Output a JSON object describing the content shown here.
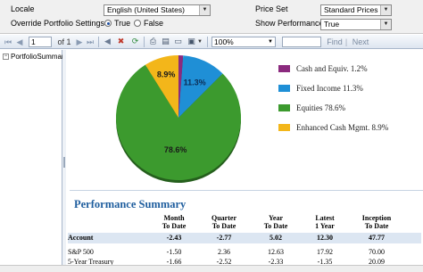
{
  "params": {
    "locale_label": "Locale",
    "locale_value": "English (United States)",
    "override_label": "Override Portfolio Settings",
    "true_label": "True",
    "false_label": "False",
    "price_set_label": "Price Set",
    "price_set_value": "Standard Prices",
    "show_perf_label": "Show Performance",
    "show_perf_value": "True"
  },
  "toolbar": {
    "page_value": "1",
    "of_label": "of 1",
    "zoom_value": "100%",
    "find_label": "Find",
    "next_label": "Next"
  },
  "docmap": {
    "node_label": "PortfolioSummary"
  },
  "chart_data": {
    "type": "pie",
    "slices": [
      {
        "label": "Cash and Equiv.",
        "value": 1.2,
        "color": "#8b2a7e"
      },
      {
        "label": "Fixed Income",
        "value": 11.3,
        "color": "#1f8fd6"
      },
      {
        "label": "Equities",
        "value": 78.6,
        "color": "#3c9a2e"
      },
      {
        "label": "Enhanced Cash Mgmt.",
        "value": 8.9,
        "color": "#f3b61a"
      }
    ],
    "data_labels": [
      "11.3%",
      "78.6%",
      "8.9%"
    ],
    "legend_position": "right"
  },
  "legend": [
    {
      "text": "Cash and Equiv. 1.2%",
      "color": "#8b2a7e"
    },
    {
      "text": "Fixed Income 11.3%",
      "color": "#1f8fd6"
    },
    {
      "text": "Equities 78.6%",
      "color": "#3c9a2e"
    },
    {
      "text": "Enhanced Cash Mgmt. 8.9%",
      "color": "#f3b61a"
    }
  ],
  "performance": {
    "title": "Performance Summary",
    "headers": [
      {
        "l1": "Month",
        "l2": "To Date"
      },
      {
        "l1": "Quarter",
        "l2": "To Date"
      },
      {
        "l1": "Year",
        "l2": "To Date"
      },
      {
        "l1": "Latest",
        "l2": "1 Year"
      },
      {
        "l1": "Inception",
        "l2": "To Date"
      }
    ],
    "rows": [
      {
        "name": "Account",
        "values": [
          "-2.43",
          "-2.77",
          "5.02",
          "12.30",
          "47.77"
        ]
      },
      {
        "name": "S&P 500",
        "values": [
          "-1.50",
          "2.36",
          "12.63",
          "17.92",
          "70.00"
        ]
      },
      {
        "name": "5-Year Treasury",
        "values": [
          "-1.66",
          "-2.52",
          "-2.33",
          "-1.35",
          "20.09"
        ]
      }
    ]
  }
}
